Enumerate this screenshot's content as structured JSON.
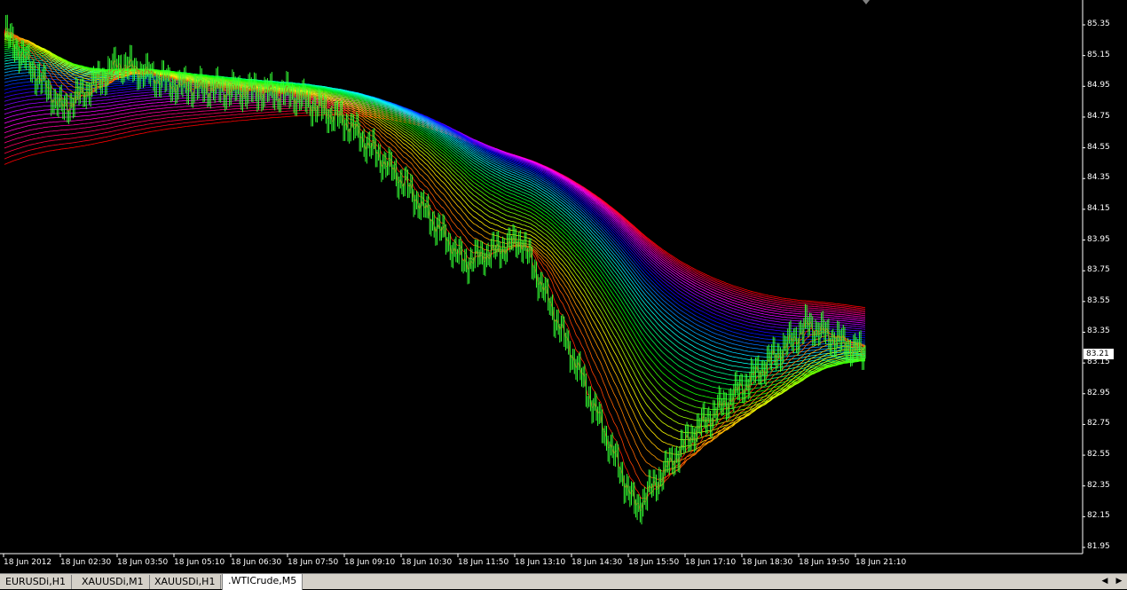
{
  "chart": {
    "symbol_period": ".WTICrude,M5",
    "current_price": "83.21",
    "colors": {
      "background": "#000000",
      "candle": "#33ff33",
      "axis_text": "#ffffff"
    }
  },
  "y_axis": {
    "labels": [
      "85.35",
      "85.15",
      "84.95",
      "84.75",
      "84.55",
      "84.35",
      "84.15",
      "83.95",
      "83.75",
      "83.55",
      "83.35",
      "83.15",
      "82.95",
      "82.75",
      "82.55",
      "82.35",
      "82.15",
      "81.95"
    ]
  },
  "x_axis": {
    "labels": [
      "18 Jun 2012",
      "18 Jun 02:30",
      "18 Jun 03:50",
      "18 Jun 05:10",
      "18 Jun 06:30",
      "18 Jun 07:50",
      "18 Jun 09:10",
      "18 Jun 10:30",
      "18 Jun 11:50",
      "18 Jun 13:10",
      "18 Jun 14:30",
      "18 Jun 15:50",
      "18 Jun 17:10",
      "18 Jun 18:30",
      "18 Jun 19:50",
      "18 Jun 21:10"
    ]
  },
  "tabs": [
    {
      "label": "EURUSDi,H1",
      "active": false
    },
    {
      "label": "XAUUSDi,M1",
      "active": false
    },
    {
      "label": "XAUUSDi,H1",
      "active": false
    },
    {
      "label": ".WTICrude,M5",
      "active": true
    }
  ],
  "chart_data": {
    "type": "line",
    "ylim": [
      81.95,
      85.35
    ],
    "x": [
      "18 Jun 2012",
      "18 Jun 02:30",
      "18 Jun 03:50",
      "18 Jun 05:10",
      "18 Jun 06:30",
      "18 Jun 07:50",
      "18 Jun 09:10",
      "18 Jun 10:30",
      "18 Jun 11:50",
      "18 Jun 13:10",
      "18 Jun 14:30",
      "18 Jun 15:50",
      "18 Jun 17:10",
      "18 Jun 18:30",
      "18 Jun 19:50",
      "18 Jun 21:10"
    ],
    "series": [
      {
        "values": [
          85.3,
          84.8,
          85.1,
          84.95,
          84.92,
          84.9,
          84.7,
          84.3,
          83.8,
          83.95,
          83.1,
          82.2,
          82.7,
          83.05,
          83.4,
          83.2
        ]
      }
    ]
  }
}
